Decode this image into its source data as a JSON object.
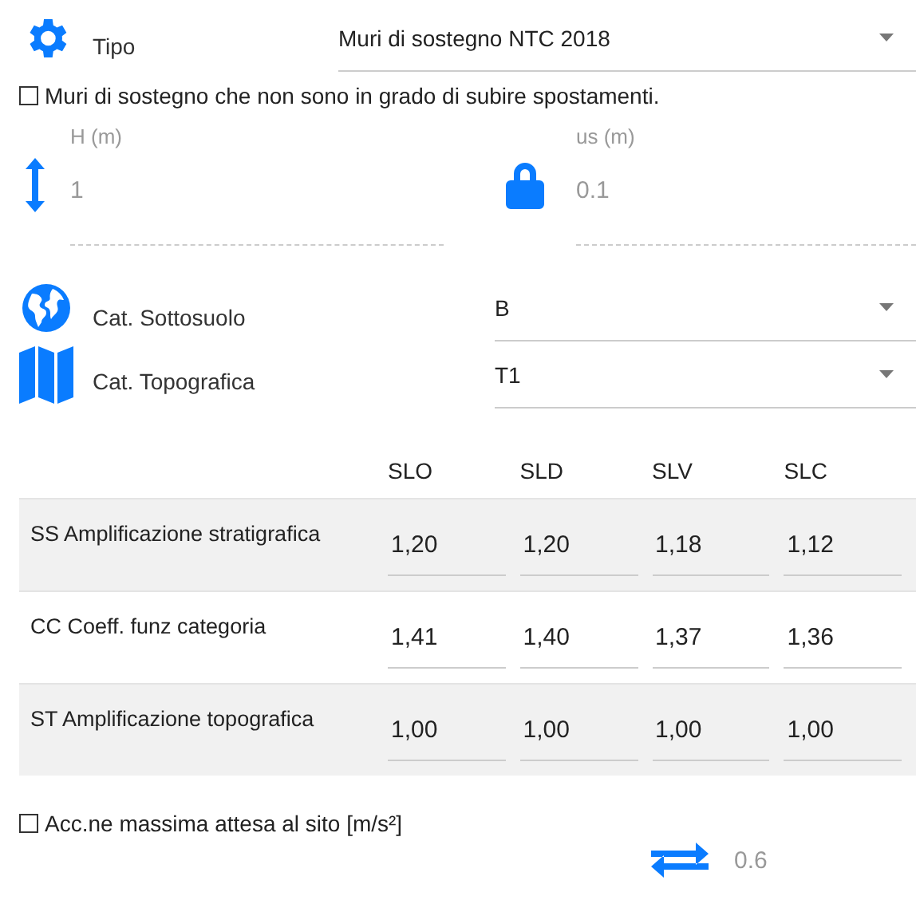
{
  "tipo": {
    "label": "Tipo",
    "value": "Muri di sostegno NTC 2018"
  },
  "fixed_walls": {
    "label": "Muri di sostegno che non sono in grado di subire spostamenti.",
    "checked": false
  },
  "fields": [
    {
      "kind": "height",
      "label": "H (m)",
      "value": "1",
      "disabled": true
    },
    {
      "kind": "lock",
      "label": "us (m)",
      "value": "0.1",
      "disabled": true
    }
  ],
  "categories": [
    {
      "kind": "globe",
      "label": "Cat. Sottosuolo",
      "value": "B"
    },
    {
      "kind": "map",
      "label": "Cat. Topografica",
      "value": "T1"
    }
  ],
  "table": {
    "columns": [
      "SLO",
      "SLD",
      "SLV",
      "SLC"
    ],
    "rows": [
      {
        "label": "SS Amplificazione stratigrafica",
        "values": [
          "1,20",
          "1,20",
          "1,18",
          "1,12"
        ]
      },
      {
        "label": "CC Coeff. funz categoria",
        "values": [
          "1,41",
          "1,40",
          "1,37",
          "1,36"
        ]
      },
      {
        "label": "ST Amplificazione topografica",
        "values": [
          "1,00",
          "1,00",
          "1,00",
          "1,00"
        ]
      }
    ]
  },
  "acceleration": {
    "label": "Acc.ne massima attesa al sito [m/s²]",
    "checked": false,
    "value": "0.6",
    "disabled": true
  }
}
